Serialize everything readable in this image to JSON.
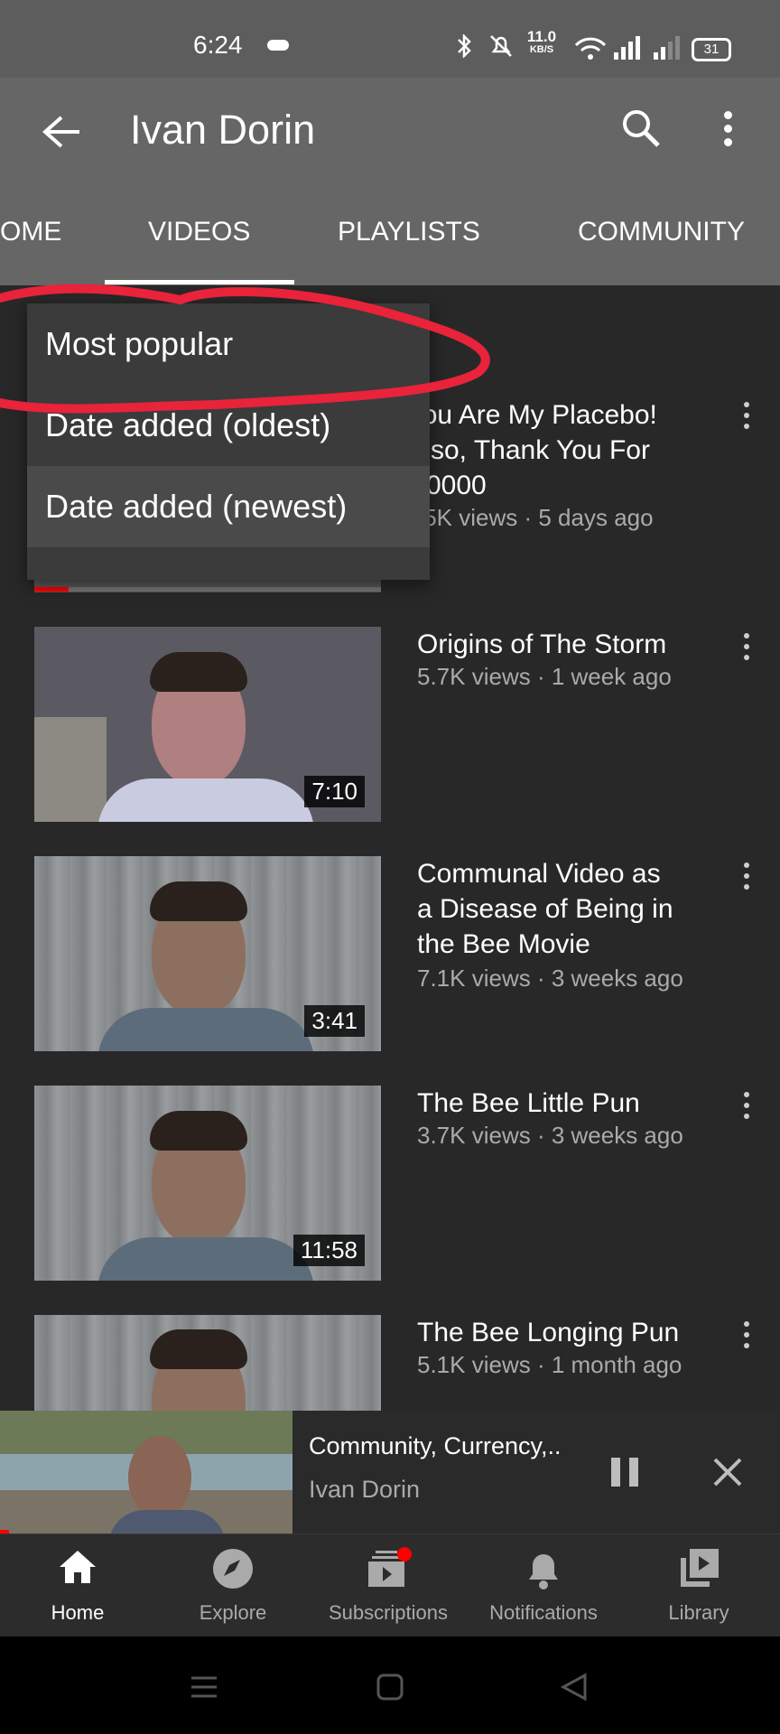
{
  "status_bar": {
    "time": "6:24",
    "net_speed_value": "11.0",
    "net_speed_unit": "KB/S",
    "battery": "31"
  },
  "header": {
    "title": "Ivan Dorin"
  },
  "tabs": [
    {
      "label": "OME"
    },
    {
      "label": "VIDEOS"
    },
    {
      "label": "PLAYLISTS"
    },
    {
      "label": "COMMUNITY"
    }
  ],
  "sort_menu": {
    "items": [
      {
        "label": "Most popular"
      },
      {
        "label": "Date added (oldest)"
      },
      {
        "label": "Date added (newest)"
      }
    ]
  },
  "videos": [
    {
      "title_lines": [
        "'ou Are My Placebo!",
        "\\lso, Thank You For",
        ")0000"
      ],
      "meta": ".5K views · 5 days ago"
    },
    {
      "title_lines": [
        "Origins of The Storm"
      ],
      "meta": "5.7K views · 1 week ago",
      "duration": "7:10"
    },
    {
      "title_lines": [
        "Communal Video as",
        "a Disease of Being in",
        "the Bee Movie"
      ],
      "meta": "7.1K views · 3 weeks ago",
      "duration": "3:41"
    },
    {
      "title_lines": [
        "The Bee Little Pun"
      ],
      "meta": "3.7K views · 3 weeks ago",
      "duration": "11:58"
    },
    {
      "title_lines": [
        "The Bee Longing Pun"
      ],
      "meta": "5.1K views · 1 month ago"
    }
  ],
  "miniplayer": {
    "title": "Community, Currency,..",
    "channel": "Ivan Dorin"
  },
  "bottom_nav": [
    {
      "label": "Home",
      "icon": "home-icon"
    },
    {
      "label": "Explore",
      "icon": "compass-icon"
    },
    {
      "label": "Subscriptions",
      "icon": "subscriptions-icon"
    },
    {
      "label": "Notifications",
      "icon": "bell-icon"
    },
    {
      "label": "Library",
      "icon": "library-icon"
    }
  ],
  "colors": {
    "accent_red": "#ff0000",
    "annotation_red": "#e8233a",
    "header_bg": "#666666",
    "page_bg": "#282828"
  }
}
